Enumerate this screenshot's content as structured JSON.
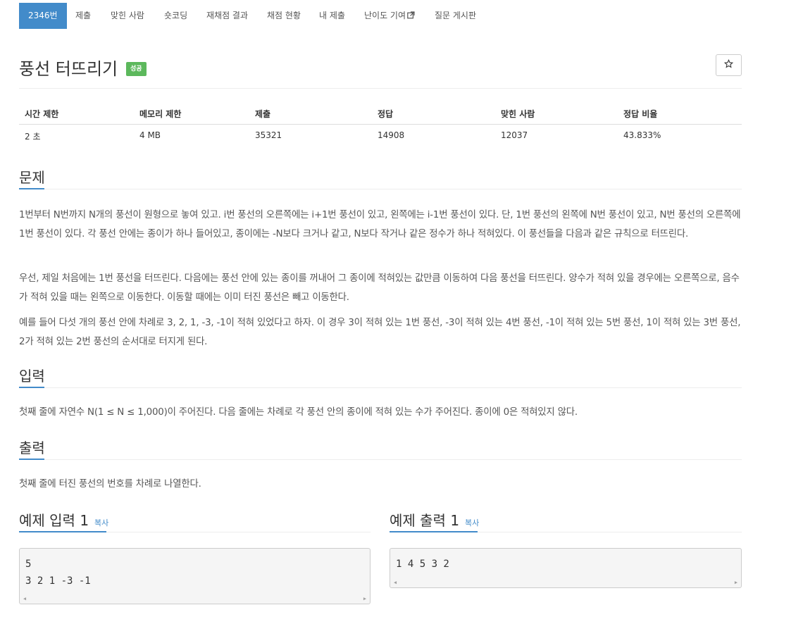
{
  "nav": {
    "items": [
      {
        "label": "2346번",
        "active": true
      },
      {
        "label": "제출"
      },
      {
        "label": "맞힌 사람"
      },
      {
        "label": "숏코딩"
      },
      {
        "label": "재채점 결과"
      },
      {
        "label": "채점 현황"
      },
      {
        "label": "내 제출"
      },
      {
        "label": "난이도 기여",
        "icon": "external-link-icon"
      },
      {
        "label": "질문 게시판"
      }
    ]
  },
  "problem": {
    "title": "풍선 터뜨리기",
    "status_badge": "성공",
    "star_icon": "star-icon"
  },
  "info_table": {
    "headers": [
      "시간 제한",
      "메모리 제한",
      "제출",
      "정답",
      "맞힌 사람",
      "정답 비율"
    ],
    "values": [
      "2 초",
      "4 MB",
      "35321",
      "14908",
      "12037",
      "43.833%"
    ]
  },
  "sections": {
    "description": {
      "title": "문제",
      "paragraphs": [
        "1번부터 N번까지 N개의 풍선이 원형으로 놓여 있고. i번 풍선의 오른쪽에는 i+1번 풍선이 있고, 왼쪽에는 i-1번 풍선이 있다. 단, 1번 풍선의 왼쪽에 N번 풍선이 있고, N번 풍선의 오른쪽에 1번 풍선이 있다. 각 풍선 안에는 종이가 하나 들어있고, 종이에는 -N보다 크거나 같고, N보다 작거나 같은 정수가 하나 적혀있다. 이 풍선들을 다음과 같은 규칙으로 터뜨린다.",
        "우선, 제일 처음에는 1번 풍선을 터뜨린다. 다음에는 풍선 안에 있는 종이를 꺼내어 그 종이에 적혀있는 값만큼 이동하여 다음 풍선을 터뜨린다. 양수가 적혀 있을 경우에는 오른쪽으로, 음수가 적혀 있을 때는 왼쪽으로 이동한다. 이동할 때에는 이미 터진 풍선은 빼고 이동한다.",
        "예를 들어 다섯 개의 풍선 안에 차례로 3, 2, 1, -3, -1이 적혀 있었다고 하자. 이 경우 3이 적혀 있는 1번 풍선, -3이 적혀 있는 4번 풍선, -1이 적혀 있는 5번 풍선, 1이 적혀 있는 3번 풍선, 2가 적혀 있는 2번 풍선의 순서대로 터지게 된다."
      ]
    },
    "input": {
      "title": "입력",
      "text": "첫째 줄에 자연수 N(1 ≤ N ≤ 1,000)이 주어진다. 다음 줄에는 차례로 각 풍선 안의 종이에 적혀 있는 수가 주어진다. 종이에 0은 적혀있지 않다."
    },
    "output": {
      "title": "출력",
      "text": "첫째 줄에 터진 풍선의 번호를 차례로 나열한다."
    }
  },
  "samples": {
    "input": {
      "title": "예제 입력 1",
      "copy_label": "복사",
      "content": "5\n3 2 1 -3 -1"
    },
    "output": {
      "title": "예제 출력 1",
      "copy_label": "복사",
      "content": "1 4 5 3 2"
    }
  },
  "colors": {
    "accent": "#428bca",
    "success": "#5cb85c",
    "sample_bg": "#f5f5f5"
  }
}
